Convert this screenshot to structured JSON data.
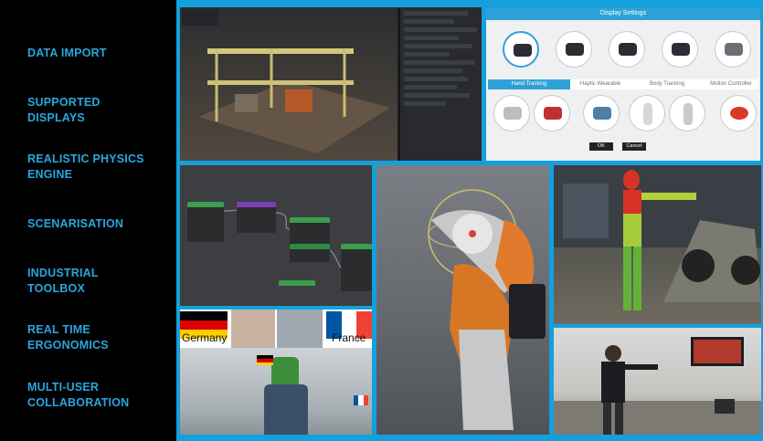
{
  "features": [
    {
      "line1": "DATA IMPORT",
      "line2": ""
    },
    {
      "line1": "SUPPORTED",
      "line2": "DISPLAYS"
    },
    {
      "line1": "REALISTIC PHYSICS",
      "line2": "ENGINE"
    },
    {
      "line1": "SCENARISATION",
      "line2": ""
    },
    {
      "line1": "INDUSTRIAL",
      "line2": "TOOLBOX"
    },
    {
      "line1": "REAL TIME",
      "line2": "ERGONOMICS"
    },
    {
      "line1": "MULTI-USER",
      "line2": "COLLABORATION"
    }
  ],
  "display_settings": {
    "title": "Display Settings",
    "tabs": [
      "Hand Tracking",
      "Haptic Wearable",
      "Body Tracking",
      "Motion Controller"
    ],
    "ok_label": "OK",
    "cancel_label": "Cancel"
  },
  "multi_user": {
    "left_country": "Germany",
    "right_country": "France"
  },
  "colors": {
    "accent": "#29a6de",
    "frame": "#14a0dc",
    "sidebar_bg": "#000000"
  }
}
